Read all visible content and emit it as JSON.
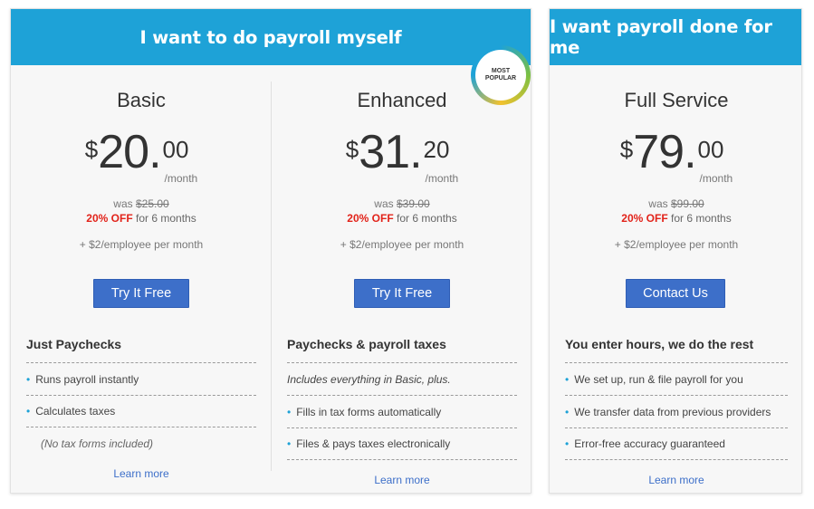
{
  "self_service": {
    "banner": "I want to do payroll myself",
    "badge": {
      "line1": "MOST",
      "line2": "POPULAR"
    },
    "plans": [
      {
        "name": "Basic",
        "currency": "$",
        "dollars": "20",
        "cents": "00",
        "per": "/month",
        "was_label": "was",
        "was_price": "$25.00",
        "discount": "20% OFF",
        "discount_rest": "for 6 months",
        "per_employee": "+ $2/employee per month",
        "cta": "Try It Free",
        "features_title": "Just Paychecks",
        "features": [
          "Runs payroll instantly",
          "Calculates taxes"
        ],
        "note": "(No tax forms included)",
        "learn_more": "Learn more"
      },
      {
        "name": "Enhanced",
        "currency": "$",
        "dollars": "31",
        "cents": "20",
        "per": "/month",
        "was_label": "was",
        "was_price": "$39.00",
        "discount": "20% OFF",
        "discount_rest": "for 6 months",
        "per_employee": "+ $2/employee per month",
        "cta": "Try It Free",
        "features_title": "Paychecks & payroll taxes",
        "intro": "Includes everything in Basic, plus.",
        "features": [
          "Fills in tax forms automatically",
          "Files & pays taxes electronically"
        ],
        "learn_more": "Learn more"
      }
    ]
  },
  "full_service": {
    "banner": "I want payroll done for me",
    "plan": {
      "name": "Full Service",
      "currency": "$",
      "dollars": "79",
      "cents": "00",
      "per": "/month",
      "was_label": "was",
      "was_price": "$99.00",
      "discount": "20% OFF",
      "discount_rest": "for 6 months",
      "per_employee": "+ $2/employee per month",
      "cta": "Contact Us",
      "features_title": "You enter hours, we do the rest",
      "features": [
        "We set up, run & file payroll for you",
        "We transfer data from previous providers",
        "Error-free accuracy guaranteed"
      ],
      "learn_more": "Learn more"
    }
  },
  "colors": {
    "banner": "#1ea2d7",
    "button": "#3d6fc9",
    "discount": "#e2231a",
    "bullet": "#1ea2d7"
  },
  "icons": {
    "bullet": "bullet-dot-icon",
    "badge": "most-popular-badge-icon"
  }
}
